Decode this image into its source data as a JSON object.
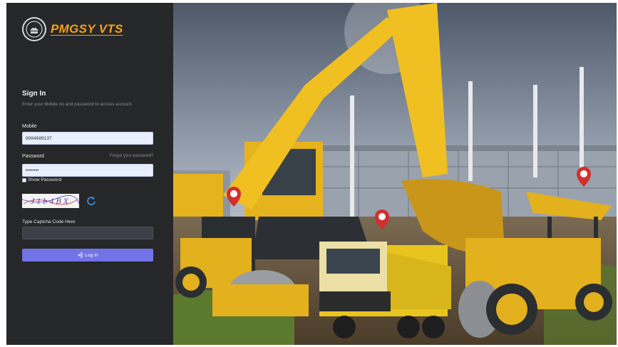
{
  "brand": {
    "name": "PMGSY VTS",
    "emblem_icon": "state-emblem-icon",
    "accent": "#f2a21d"
  },
  "signin": {
    "title": "Sign In",
    "subtitle": "Enter your Mobile no and password to access account.",
    "mobile_label": "Mobile",
    "mobile_value": "8984689137",
    "password_label": "Password",
    "forgot_link": "Forgot your password?",
    "password_value": "••••••••",
    "show_password_label": "Show Password",
    "captcha_text": "J1b4BX",
    "captcha_input_label": "Type Captcha Code Here",
    "captcha_input_value": "",
    "login_button": "Log In",
    "login_icon": "sign-in-icon",
    "refresh_icon": "refresh-icon"
  },
  "colors": {
    "panel": "#262729",
    "button": "#7173e6",
    "input_bg": "#e8effc"
  }
}
